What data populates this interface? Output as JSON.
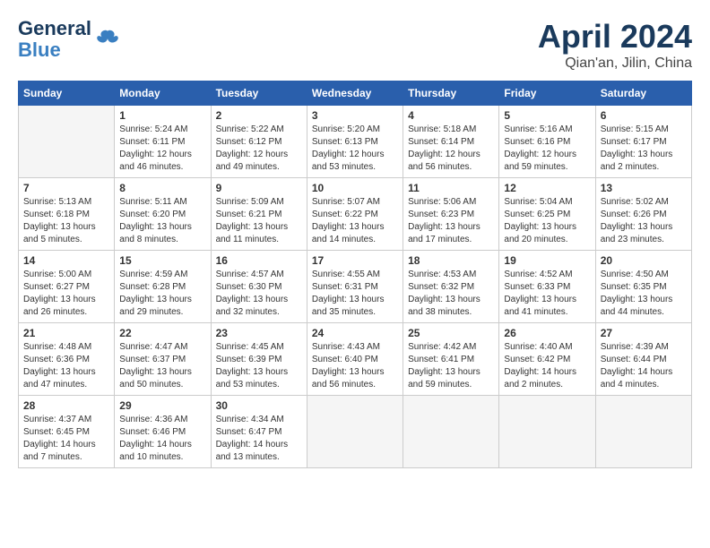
{
  "header": {
    "logo_line1": "General",
    "logo_line2": "Blue",
    "month": "April 2024",
    "location": "Qian'an, Jilin, China"
  },
  "weekdays": [
    "Sunday",
    "Monday",
    "Tuesday",
    "Wednesday",
    "Thursday",
    "Friday",
    "Saturday"
  ],
  "weeks": [
    [
      {
        "day": "",
        "info": ""
      },
      {
        "day": "1",
        "info": "Sunrise: 5:24 AM\nSunset: 6:11 PM\nDaylight: 12 hours\nand 46 minutes."
      },
      {
        "day": "2",
        "info": "Sunrise: 5:22 AM\nSunset: 6:12 PM\nDaylight: 12 hours\nand 49 minutes."
      },
      {
        "day": "3",
        "info": "Sunrise: 5:20 AM\nSunset: 6:13 PM\nDaylight: 12 hours\nand 53 minutes."
      },
      {
        "day": "4",
        "info": "Sunrise: 5:18 AM\nSunset: 6:14 PM\nDaylight: 12 hours\nand 56 minutes."
      },
      {
        "day": "5",
        "info": "Sunrise: 5:16 AM\nSunset: 6:16 PM\nDaylight: 12 hours\nand 59 minutes."
      },
      {
        "day": "6",
        "info": "Sunrise: 5:15 AM\nSunset: 6:17 PM\nDaylight: 13 hours\nand 2 minutes."
      }
    ],
    [
      {
        "day": "7",
        "info": "Sunrise: 5:13 AM\nSunset: 6:18 PM\nDaylight: 13 hours\nand 5 minutes."
      },
      {
        "day": "8",
        "info": "Sunrise: 5:11 AM\nSunset: 6:20 PM\nDaylight: 13 hours\nand 8 minutes."
      },
      {
        "day": "9",
        "info": "Sunrise: 5:09 AM\nSunset: 6:21 PM\nDaylight: 13 hours\nand 11 minutes."
      },
      {
        "day": "10",
        "info": "Sunrise: 5:07 AM\nSunset: 6:22 PM\nDaylight: 13 hours\nand 14 minutes."
      },
      {
        "day": "11",
        "info": "Sunrise: 5:06 AM\nSunset: 6:23 PM\nDaylight: 13 hours\nand 17 minutes."
      },
      {
        "day": "12",
        "info": "Sunrise: 5:04 AM\nSunset: 6:25 PM\nDaylight: 13 hours\nand 20 minutes."
      },
      {
        "day": "13",
        "info": "Sunrise: 5:02 AM\nSunset: 6:26 PM\nDaylight: 13 hours\nand 23 minutes."
      }
    ],
    [
      {
        "day": "14",
        "info": "Sunrise: 5:00 AM\nSunset: 6:27 PM\nDaylight: 13 hours\nand 26 minutes."
      },
      {
        "day": "15",
        "info": "Sunrise: 4:59 AM\nSunset: 6:28 PM\nDaylight: 13 hours\nand 29 minutes."
      },
      {
        "day": "16",
        "info": "Sunrise: 4:57 AM\nSunset: 6:30 PM\nDaylight: 13 hours\nand 32 minutes."
      },
      {
        "day": "17",
        "info": "Sunrise: 4:55 AM\nSunset: 6:31 PM\nDaylight: 13 hours\nand 35 minutes."
      },
      {
        "day": "18",
        "info": "Sunrise: 4:53 AM\nSunset: 6:32 PM\nDaylight: 13 hours\nand 38 minutes."
      },
      {
        "day": "19",
        "info": "Sunrise: 4:52 AM\nSunset: 6:33 PM\nDaylight: 13 hours\nand 41 minutes."
      },
      {
        "day": "20",
        "info": "Sunrise: 4:50 AM\nSunset: 6:35 PM\nDaylight: 13 hours\nand 44 minutes."
      }
    ],
    [
      {
        "day": "21",
        "info": "Sunrise: 4:48 AM\nSunset: 6:36 PM\nDaylight: 13 hours\nand 47 minutes."
      },
      {
        "day": "22",
        "info": "Sunrise: 4:47 AM\nSunset: 6:37 PM\nDaylight: 13 hours\nand 50 minutes."
      },
      {
        "day": "23",
        "info": "Sunrise: 4:45 AM\nSunset: 6:39 PM\nDaylight: 13 hours\nand 53 minutes."
      },
      {
        "day": "24",
        "info": "Sunrise: 4:43 AM\nSunset: 6:40 PM\nDaylight: 13 hours\nand 56 minutes."
      },
      {
        "day": "25",
        "info": "Sunrise: 4:42 AM\nSunset: 6:41 PM\nDaylight: 13 hours\nand 59 minutes."
      },
      {
        "day": "26",
        "info": "Sunrise: 4:40 AM\nSunset: 6:42 PM\nDaylight: 14 hours\nand 2 minutes."
      },
      {
        "day": "27",
        "info": "Sunrise: 4:39 AM\nSunset: 6:44 PM\nDaylight: 14 hours\nand 4 minutes."
      }
    ],
    [
      {
        "day": "28",
        "info": "Sunrise: 4:37 AM\nSunset: 6:45 PM\nDaylight: 14 hours\nand 7 minutes."
      },
      {
        "day": "29",
        "info": "Sunrise: 4:36 AM\nSunset: 6:46 PM\nDaylight: 14 hours\nand 10 minutes."
      },
      {
        "day": "30",
        "info": "Sunrise: 4:34 AM\nSunset: 6:47 PM\nDaylight: 14 hours\nand 13 minutes."
      },
      {
        "day": "",
        "info": ""
      },
      {
        "day": "",
        "info": ""
      },
      {
        "day": "",
        "info": ""
      },
      {
        "day": "",
        "info": ""
      }
    ]
  ]
}
